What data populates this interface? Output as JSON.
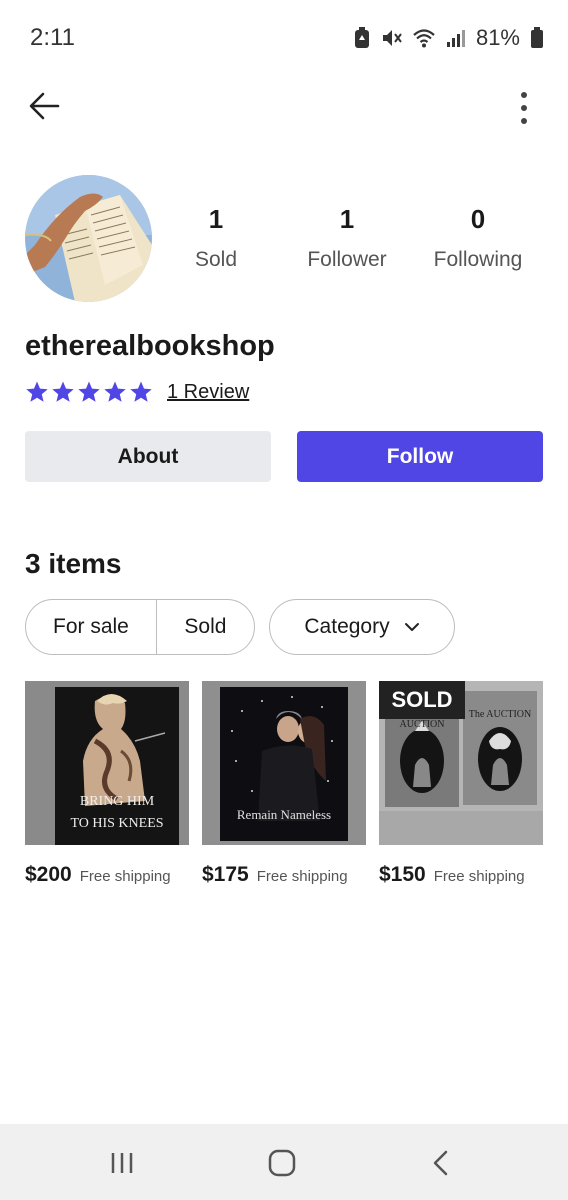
{
  "status_bar": {
    "time": "2:11",
    "battery_percent": "81%",
    "icons": [
      "battery-saver-icon",
      "mute-icon",
      "wifi-icon",
      "signal-icon",
      "battery-icon"
    ]
  },
  "profile": {
    "username": "etherealbookshop",
    "rating_stars": 5,
    "review_label": "1 Review",
    "stats": [
      {
        "count": "1",
        "label": "Sold"
      },
      {
        "count": "1",
        "label": "Follower"
      },
      {
        "count": "0",
        "label": "Following"
      }
    ]
  },
  "actions": {
    "about_label": "About",
    "follow_label": "Follow"
  },
  "items": {
    "title": "3 items",
    "filters": {
      "for_sale_label": "For sale",
      "sold_label": "Sold",
      "category_label": "Category"
    },
    "products": [
      {
        "price": "$200",
        "shipping": "Free shipping",
        "cover_text_line1": "BRING HIM",
        "cover_text_line2": "TO HIS KNEES",
        "sold": false
      },
      {
        "price": "$175",
        "shipping": "Free shipping",
        "cover_text_line1": "Remain Nameless",
        "cover_text_line2": "",
        "sold": false
      },
      {
        "price": "$150",
        "shipping": "Free shipping",
        "cover_text_line1": "AUCTION",
        "cover_text_line2": "The AUCTION",
        "sold": true,
        "badge": "SOLD"
      }
    ]
  },
  "colors": {
    "accent": "#5046e5",
    "star": "#5046e5",
    "about_bg": "#e9eaee",
    "nav_bg": "#f0f0f0"
  }
}
